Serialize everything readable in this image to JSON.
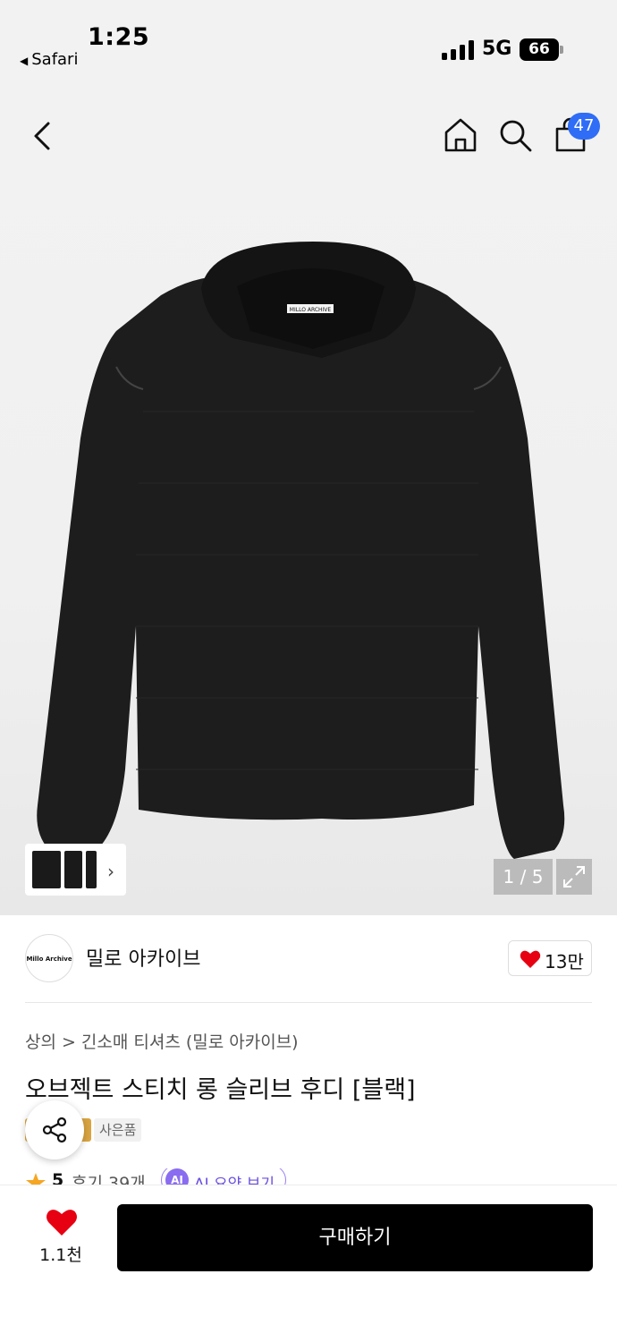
{
  "status_bar": {
    "time": "1:25",
    "back_app": "Safari",
    "network": "5G",
    "battery": "66"
  },
  "header": {
    "cart_count": "47"
  },
  "gallery": {
    "counter": "1 / 5",
    "product_label_text": "MILLO ARCHIVE"
  },
  "brand": {
    "logo_text": "Millo Archive",
    "name": "밀로 아카이브",
    "like_count": "13만"
  },
  "product": {
    "breadcrumb": [
      "상의",
      ">",
      "긴소매 티셔츠 (밀로 아카이브)"
    ],
    "title": "오브젝트 스티치 롱 슬리브 후디 [블랙]",
    "tag_gift": "사은품",
    "rating": "5",
    "review": "후기 39개",
    "ai_badge": "AI",
    "ai_label": "AI 요약 보기"
  },
  "bottom": {
    "wish_count": "1.1천",
    "buy_label": "구매하기"
  },
  "colors": {
    "accent_blue": "#2f6df6",
    "heart_red": "#e60012",
    "buy_black": "#000000",
    "ai_purple": "#8a6cf0"
  }
}
